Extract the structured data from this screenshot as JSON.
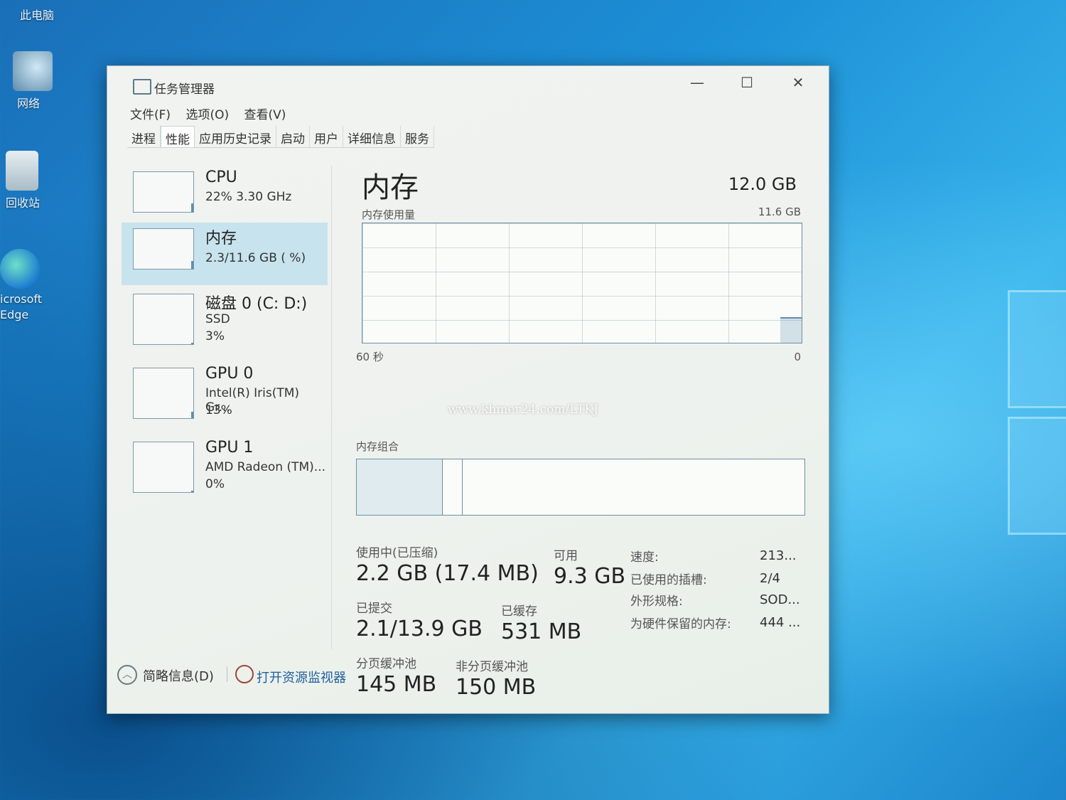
{
  "desktop": {
    "icons": [
      {
        "label": "此电脑"
      },
      {
        "label": "网络"
      },
      {
        "label": "回收站"
      },
      {
        "label": "icrosoft\nEdge"
      }
    ]
  },
  "window": {
    "title": "任务管理器",
    "controls": {
      "minimize": "—",
      "maximize": "☐",
      "close": "✕"
    },
    "menu": [
      "文件(F)",
      "选项(O)",
      "查看(V)"
    ],
    "tabs": [
      "进程",
      "性能",
      "应用历史记录",
      "启动",
      "用户",
      "详细信息",
      "服务"
    ],
    "active_tab": "性能"
  },
  "sidebar": {
    "items": [
      {
        "name": "CPU",
        "line1": "22% 3.30 GHz",
        "line2": "",
        "usage": 0.22
      },
      {
        "name": "内存",
        "line1": "2.3/11.6 GB (  %)",
        "line2": "",
        "usage": 0.2
      },
      {
        "name": "磁盘 0 (C: D:)",
        "line1": "SSD",
        "line2": "3%",
        "usage": 0.03
      },
      {
        "name": "GPU 0",
        "line1": "Intel(R) Iris(TM) Gr...",
        "line2": "13%",
        "usage": 0.13
      },
      {
        "name": "GPU 1",
        "line1": "AMD Radeon (TM)...",
        "line2": "0%",
        "usage": 0.0
      }
    ],
    "selected_index": 1
  },
  "main": {
    "title": "内存",
    "total": "12.0 GB",
    "usage_label": "内存使用量",
    "usage_max": "11.6 GB",
    "axis_left": "60 秒",
    "axis_right": "0",
    "composition_label": "内存组合",
    "composition": {
      "in_use_fraction": 0.19,
      "modified_fraction": 0.045
    },
    "stats": {
      "in_use_label": "使用中(已压缩)",
      "in_use_value": "2.2 GB (17.4 MB)",
      "available_label": "可用",
      "available_value": "9.3 GB",
      "committed_label": "已提交",
      "committed_value": "2.1/13.9 GB",
      "cached_label": "已缓存",
      "cached_value": "531 MB",
      "paged_label": "分页缓冲池",
      "paged_value": "145 MB",
      "nonpaged_label": "非分页缓冲池",
      "nonpaged_value": "150 MB"
    },
    "details": [
      {
        "label": "速度:",
        "value": "213..."
      },
      {
        "label": "已使用的插槽:",
        "value": "2/4"
      },
      {
        "label": "外形规格:",
        "value": "SOD..."
      },
      {
        "label": "为硬件保留的内存:",
        "value": "444 ..."
      }
    ]
  },
  "footer": {
    "brief": "简略信息(D)",
    "resmon": "打开资源监视器"
  },
  "watermark": "www.khmer24.com/LTKJ",
  "colors": {
    "selected_bg": "#c7e3ee",
    "graph_line": "#5d8fb0",
    "link": "#1f5f9e"
  }
}
